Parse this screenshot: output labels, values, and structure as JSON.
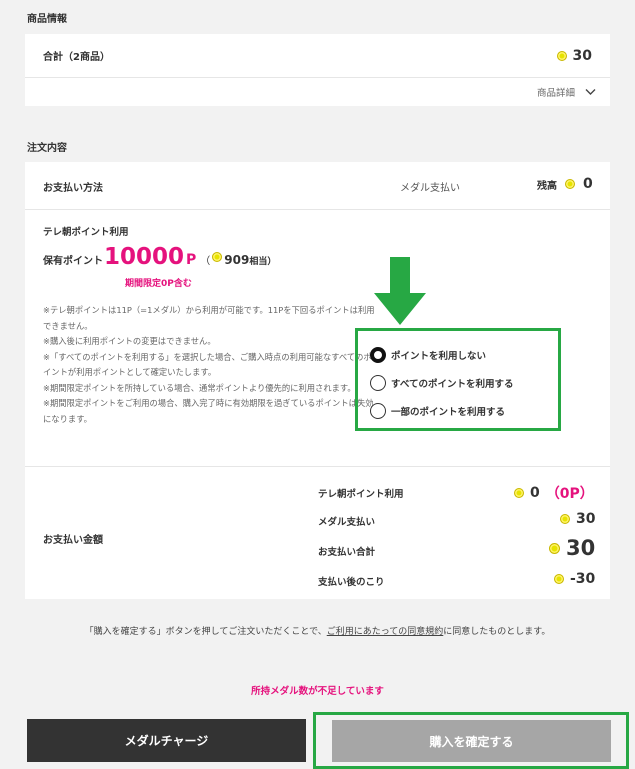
{
  "product_section": {
    "title": "商品情報",
    "total_label": "合計（2商品）",
    "total_value": "30",
    "detail_link": "商品詳細"
  },
  "order_section": {
    "title": "注文内容",
    "payment_method_label": "お支払い方法",
    "payment_method_value": "メダル支払い",
    "balance_label": "残高",
    "balance_value": "0"
  },
  "points": {
    "title": "テレ朝ポイント利用",
    "held_label": "保有ポイント",
    "held_value": "10000",
    "held_unit": "P",
    "paren_open": "（",
    "equiv_value": "909",
    "equiv_suffix": "相当）",
    "limited_note": "期間限定0P含む",
    "notes": [
      "※テレ朝ポイントは11P（=1メダル）から利用が可能です。11Pを下回るポイントは利用できません。",
      "※購入後に利用ポイントの変更はできません。",
      "※「すべてのポイントを利用する」を選択した場合、ご購入時点の利用可能なすべてのポイントが利用ポイントとして確定いたします。",
      "※期間限定ポイントを所持している場合、通常ポイントより優先的に利用されます。",
      "※期間限定ポイントをご利用の場合、購入完了時に有効期限を過ぎているポイントは失効になります。"
    ],
    "options": [
      {
        "label": "ポイントを利用しない",
        "selected": true
      },
      {
        "label": "すべてのポイントを利用する",
        "selected": false
      },
      {
        "label": "一部のポイントを利用する",
        "selected": false
      }
    ]
  },
  "payment_summary": {
    "label": "お支払い金額",
    "point_use_label": "テレ朝ポイント利用",
    "point_use_value": "0",
    "point_use_paren": "（0P）",
    "medal_label": "メダル支払い",
    "medal_value": "30",
    "total_label": "お支払い合計",
    "total_value": "30",
    "remaining_label": "支払い後のこり",
    "remaining_value": "-30"
  },
  "agreement": {
    "prefix": "「購入を確定する」ボタンを押してご注文いただくことで、",
    "link": "ご利用にあたっての同意規約",
    "suffix": "に同意したものとします。"
  },
  "warning": "所持メダル数が不足しています",
  "buttons": {
    "charge": "メダルチャージ",
    "confirm": "購入を確定する"
  },
  "colors": {
    "accent_pink": "#e5127d",
    "highlight_green": "#27a844",
    "coin_yellow": "#e7e300",
    "dark_button": "#333333",
    "disabled_button": "#a6a6a6"
  }
}
